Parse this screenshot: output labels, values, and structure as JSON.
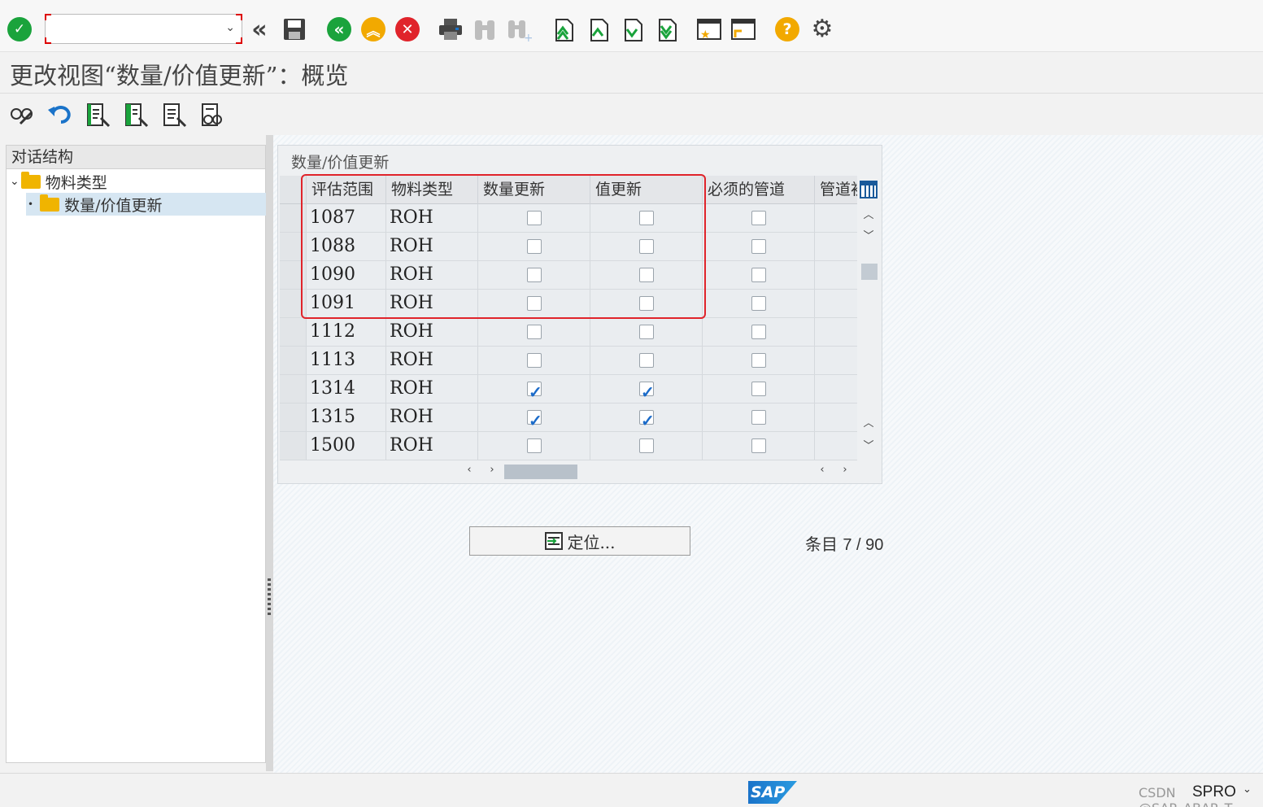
{
  "toolbar": {
    "command_field": {
      "value": "",
      "placeholder": ""
    },
    "icons": [
      "enter-icon",
      "expand-history-icon",
      "save-icon",
      "back-icon",
      "exit-icon",
      "cancel-icon",
      "print-icon",
      "find-icon",
      "find-next-icon",
      "first-page-icon",
      "previous-page-icon",
      "next-page-icon",
      "last-page-icon",
      "create-session-icon",
      "shortcut-icon",
      "help-icon",
      "settings-icon"
    ],
    "help_glyph": "?"
  },
  "page_title": "更改视图“数量/价值更新”：概览",
  "tree": {
    "header": "对话结构",
    "items": [
      {
        "label": "物料类型",
        "level": 0,
        "expanded": true
      },
      {
        "label": "数量/价值更新",
        "level": 1,
        "selected": true
      }
    ]
  },
  "table": {
    "title": "数量/价值更新",
    "columns": [
      "评估范围",
      "物料类型",
      "数量更新",
      "值更新",
      "必须的管道",
      "管道初"
    ],
    "rows": [
      {
        "valuation_area": "1087",
        "material_type": "ROH",
        "qty_update": false,
        "value_update": false,
        "pipeline_mandatory": false
      },
      {
        "valuation_area": "1088",
        "material_type": "ROH",
        "qty_update": false,
        "value_update": false,
        "pipeline_mandatory": false
      },
      {
        "valuation_area": "1090",
        "material_type": "ROH",
        "qty_update": false,
        "value_update": false,
        "pipeline_mandatory": false
      },
      {
        "valuation_area": "1091",
        "material_type": "ROH",
        "qty_update": false,
        "value_update": false,
        "pipeline_mandatory": false
      },
      {
        "valuation_area": "1112",
        "material_type": "ROH",
        "qty_update": false,
        "value_update": false,
        "pipeline_mandatory": false
      },
      {
        "valuation_area": "1113",
        "material_type": "ROH",
        "qty_update": false,
        "value_update": false,
        "pipeline_mandatory": false
      },
      {
        "valuation_area": "1314",
        "material_type": "ROH",
        "qty_update": true,
        "value_update": true,
        "pipeline_mandatory": false
      },
      {
        "valuation_area": "1315",
        "material_type": "ROH",
        "qty_update": true,
        "value_update": true,
        "pipeline_mandatory": false
      },
      {
        "valuation_area": "1500",
        "material_type": "ROH",
        "qty_update": false,
        "value_update": false,
        "pipeline_mandatory": false
      }
    ]
  },
  "position_button": {
    "label": "定位..."
  },
  "entries": {
    "label": "条目",
    "current": "7",
    "total": "90"
  },
  "status_bar": {
    "sap_logo": "SAP",
    "watermark": "CSDN @SAP_ABAP_T",
    "transaction": "SPRO"
  },
  "colors": {
    "accent": "#1a73c9",
    "ok_green": "#1aa33c",
    "cancel_red": "#e0242b",
    "warn_orange": "#f2a900",
    "highlight_red": "#e0242b"
  }
}
